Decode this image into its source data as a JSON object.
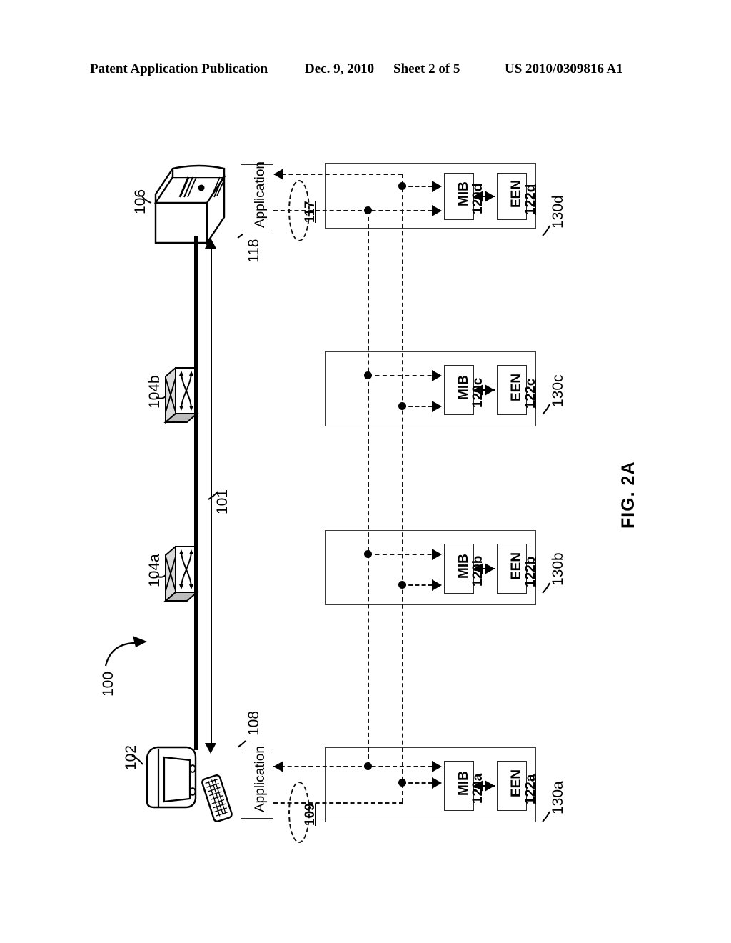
{
  "header": {
    "publication": "Patent Application Publication",
    "date": "Dec. 9, 2010",
    "sheet": "Sheet 2 of 5",
    "patent_number": "US 2010/0309816 A1"
  },
  "figure": {
    "label": "FIG. 2A",
    "system_ref": "100",
    "network_link_ref": "101"
  },
  "devices": {
    "server": {
      "ref": "106",
      "icon": "server-icon"
    },
    "workstation": {
      "ref": "102",
      "icon": "computer-workstation-icon"
    },
    "switch_upper": {
      "ref": "104b",
      "icon": "network-switch-icon"
    },
    "switch_lower": {
      "ref": "104a",
      "icon": "network-switch-icon"
    }
  },
  "applications": [
    {
      "id": "app-118",
      "label": "Application",
      "ref": "118",
      "callout": "117"
    },
    {
      "id": "app-108",
      "label": "Application",
      "ref": "108",
      "callout": "109"
    }
  ],
  "nodes": [
    {
      "id": "node-130d",
      "ref": "130d",
      "mib": {
        "label": "MIB",
        "num": "120d"
      },
      "een": {
        "label": "EEN",
        "num": "122d"
      }
    },
    {
      "id": "node-130c",
      "ref": "130c",
      "mib": {
        "label": "MIB",
        "num": "120c"
      },
      "een": {
        "label": "EEN",
        "num": "122c"
      }
    },
    {
      "id": "node-130b",
      "ref": "130b",
      "mib": {
        "label": "MIB",
        "num": "120b"
      },
      "een": {
        "label": "EEN",
        "num": "122b"
      }
    },
    {
      "id": "node-130a",
      "ref": "130a",
      "mib": {
        "label": "MIB",
        "num": "120a"
      },
      "een": {
        "label": "EEN",
        "num": "122a"
      }
    }
  ],
  "colors": {
    "ink": "#000000",
    "block_border": "#3a3a3a",
    "paper": "#ffffff"
  }
}
